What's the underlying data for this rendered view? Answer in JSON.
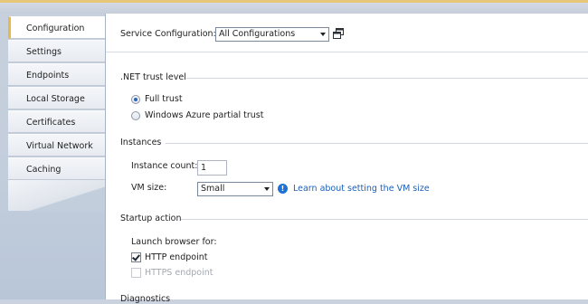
{
  "sidebar": {
    "items": [
      {
        "label": "Configuration"
      },
      {
        "label": "Settings"
      },
      {
        "label": "Endpoints"
      },
      {
        "label": "Local Storage"
      },
      {
        "label": "Certificates"
      },
      {
        "label": "Virtual Network"
      },
      {
        "label": "Caching"
      }
    ],
    "active_index": 0
  },
  "service_config": {
    "label": "Service Configuration:",
    "selected": "All Configurations",
    "manage_icon": "copy-configurations-icon"
  },
  "trust": {
    "title": ".NET trust level",
    "options": [
      {
        "label": "Full trust",
        "checked": true
      },
      {
        "label": "Windows Azure partial trust",
        "checked": false
      }
    ]
  },
  "instances": {
    "title": "Instances",
    "count_label": "Instance count:",
    "count_value": "1",
    "vm_label": "VM size:",
    "vm_selected": "Small",
    "info_icon": "info-icon",
    "learn_link": "Learn about setting the VM size"
  },
  "startup": {
    "title": "Startup action",
    "launch_label": "Launch browser for:",
    "http": {
      "label": "HTTP endpoint",
      "checked": true
    },
    "https": {
      "label": "HTTPS endpoint",
      "checked": false,
      "disabled": true
    }
  },
  "diagnostics": {
    "title": "Diagnostics"
  },
  "colors": {
    "accent_tab": "#e8b84a",
    "link": "#1c5fb6",
    "info": "#1d72d3"
  }
}
